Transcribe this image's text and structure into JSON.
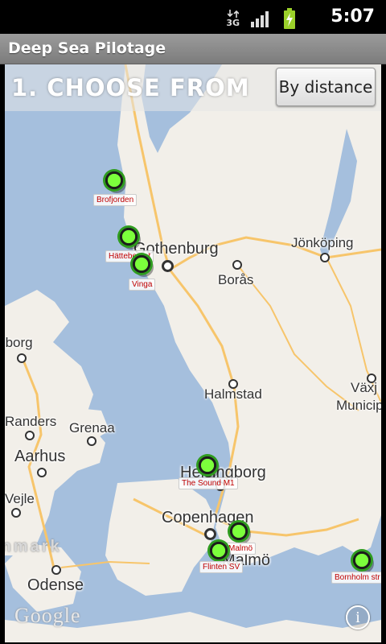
{
  "status_bar": {
    "network_label": "3G",
    "time": "5:07"
  },
  "app": {
    "title": "Deep Sea Pilotage"
  },
  "map": {
    "heading": "1. CHOOSE FROM",
    "sort_button_label": "By distance",
    "attribution": "Google",
    "info_label": "i",
    "cities": [
      {
        "name": "Gothenburg"
      },
      {
        "name": "Jönköping"
      },
      {
        "name": "Borås"
      },
      {
        "name": "Aalborg"
      },
      {
        "name": "Halmstad"
      },
      {
        "name": "Växj"
      },
      {
        "name": "Municip"
      },
      {
        "name": "Randers"
      },
      {
        "name": "Grenaa"
      },
      {
        "name": "Aarhus"
      },
      {
        "name": "Helsingborg"
      },
      {
        "name": "Vejle"
      },
      {
        "name": "Copenhagen"
      },
      {
        "name": "Malmö"
      },
      {
        "name": "Odense"
      }
    ],
    "country_label": "Denmark",
    "pilot_stations": [
      {
        "name": "Brofjorden"
      },
      {
        "name": "Hätteberget"
      },
      {
        "name": "Vinga"
      },
      {
        "name": "The Sound M1"
      },
      {
        "name": "Malmö"
      },
      {
        "name": "Flinten SV"
      },
      {
        "name": "Bornholm str"
      }
    ],
    "colors": {
      "water": "#a5bfdd",
      "land": "#f2efe9",
      "road": "#f7c56b",
      "marker": "#7cff3c",
      "station_label_text": "#c00000"
    }
  }
}
